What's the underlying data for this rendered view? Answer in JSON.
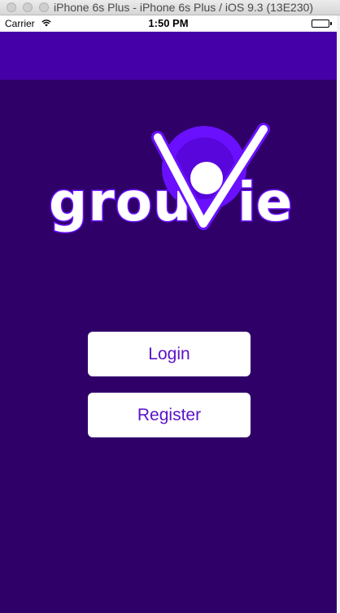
{
  "window": {
    "title": "iPhone 6s Plus - iPhone 6s Plus / iOS 9.3 (13E230)"
  },
  "status_bar": {
    "carrier": "Carrier",
    "time": "1:50 PM"
  },
  "logo": {
    "text_left": "grou",
    "text_right": "ie",
    "colors": {
      "text": "#ffffff",
      "outline": "#6a10ff",
      "circle": "#6a10ff",
      "circle_inner": "#4d00c4"
    }
  },
  "buttons": {
    "login_label": "Login",
    "register_label": "Register"
  },
  "colors": {
    "background": "#300069",
    "navbar": "#4500a7",
    "button_text": "#5a12c7"
  }
}
